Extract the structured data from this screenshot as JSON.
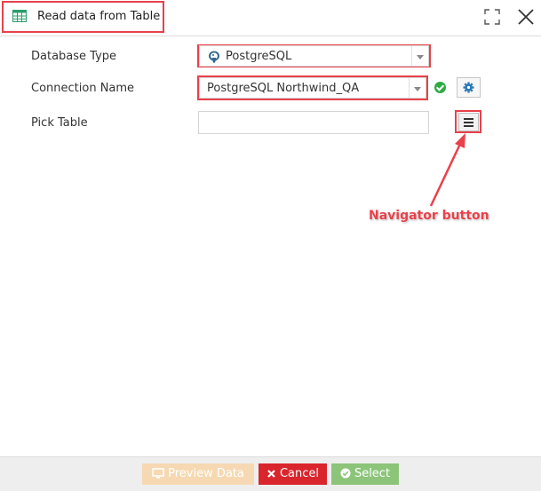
{
  "window": {
    "title": "Read data from Table"
  },
  "form": {
    "database_type_label": "Database Type",
    "database_type_value": "PostgreSQL",
    "connection_name_label": "Connection Name",
    "connection_name_value": "PostgreSQL Northwind_QA",
    "pick_table_label": "Pick Table",
    "pick_table_value": ""
  },
  "annotation": {
    "callout_text": "Navigator button"
  },
  "footer": {
    "preview_label": "Preview Data",
    "cancel_label": "Cancel",
    "select_label": "Select"
  },
  "icons": {
    "title": "table-icon",
    "maximize": "maximize-icon",
    "close": "close-icon",
    "database": "postgresql-icon",
    "status": "check-circle-icon",
    "settings": "gear-icon",
    "navigator": "hamburger-icon"
  },
  "colors": {
    "highlight": "#e8414b",
    "cancel": "#d9252c",
    "select": "#8cc57a",
    "preview": "#f6d9b2",
    "status_ok": "#2eab43",
    "gear": "#2a7ab8"
  }
}
